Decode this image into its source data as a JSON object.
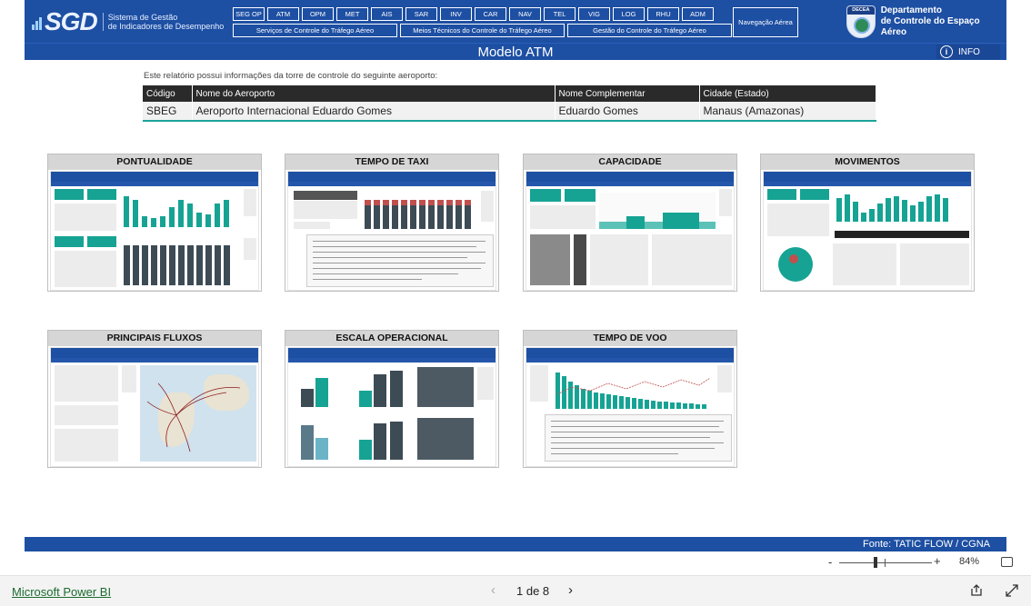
{
  "header": {
    "logo_mark": "SGD",
    "logo_text_line1": "Sistema de Gestão",
    "logo_text_line2": "de Indicadores de Desempenho",
    "nav_top": [
      "SEG OP",
      "ATM",
      "OPM",
      "MET",
      "AIS",
      "SAR",
      "INV",
      "CAR",
      "NAV",
      "TEL",
      "VIG",
      "LOG",
      "RHU",
      "ADM"
    ],
    "nav_bottom": [
      "Serviços de Controle do Tráfego Aéreo",
      "Meios Técnicos do Controle do Tráfego Aéreo",
      "Gestão do Controle do Tráfego Aéreo"
    ],
    "nav_aerea": "Navegação Aérea",
    "decea_badge": "DECEA",
    "decea_line1": "Departamento",
    "decea_line2": "de Controle do Espaço Aéreo"
  },
  "titlebar": {
    "title": "Modelo ATM",
    "info_label": "INFO"
  },
  "intro": "Este relatório possui informações da torre de controle do seguinte aeroporto:",
  "airport_table": {
    "headers": [
      "Código",
      "Nome do Aeroporto",
      "Nome Complementar",
      "Cidade (Estado)"
    ],
    "row": [
      "SBEG",
      "Aeroporto Internacional Eduardo Gomes",
      "Eduardo Gomes",
      "Manaus (Amazonas)"
    ]
  },
  "cards": [
    {
      "label": "PONTUALIDADE"
    },
    {
      "label": "TEMPO DE TAXI"
    },
    {
      "label": "CAPACIDADE"
    },
    {
      "label": "MOVIMENTOS"
    },
    {
      "label": "PRINCIPAIS FLUXOS"
    },
    {
      "label": "ESCALA OPERACIONAL"
    },
    {
      "label": "TEMPO DE VOO"
    }
  ],
  "fonte": "Fonte: TATIC FLOW / CGNA",
  "zoom": {
    "minus": "-",
    "plus": "+",
    "value": "84%"
  },
  "footer": {
    "app_link": "Microsoft Power BI",
    "page_text": "1 de 8",
    "prev": "‹",
    "next": "›"
  },
  "colors": {
    "brand_blue": "#1d4fa3",
    "teal": "#16a394",
    "table_header": "#2a2a2a"
  }
}
